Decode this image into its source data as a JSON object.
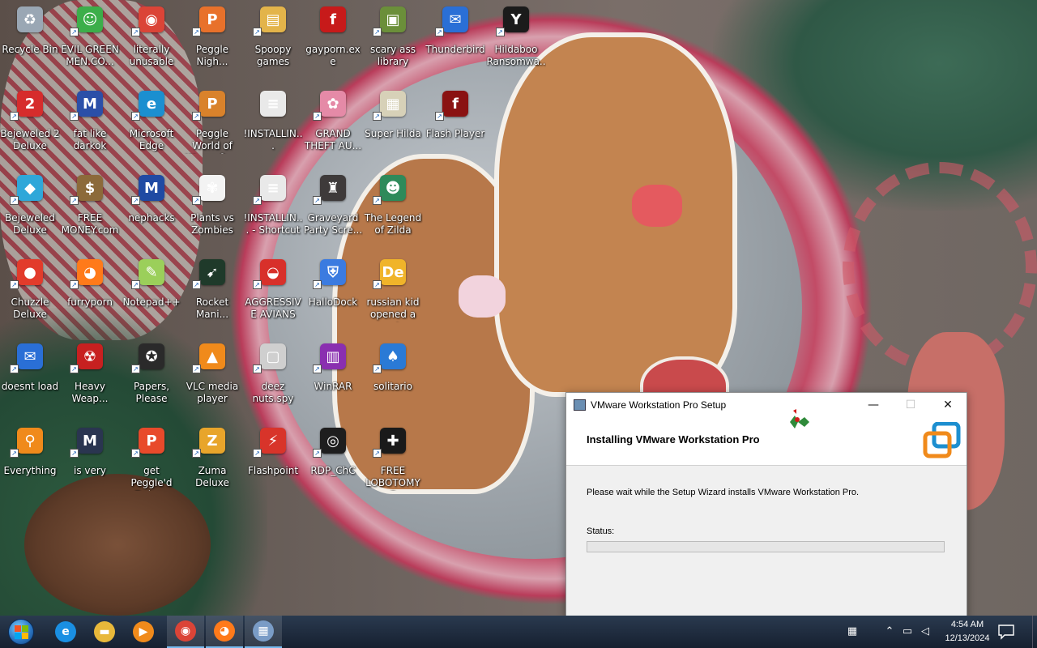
{
  "desktop_icons": [
    {
      "label": "Recycle Bin",
      "icon": "recycle-bin-icon",
      "color": "#9aa7b4",
      "glyph": "♻",
      "shortcut": false
    },
    {
      "label": "EVIL GREEN MEN.CO...",
      "icon": "people-icon",
      "color": "#3cae4a",
      "glyph": "☺",
      "shortcut": true
    },
    {
      "label": "literally unusable",
      "icon": "chrome-icon",
      "color": "#db4437",
      "glyph": "◉",
      "shortcut": true
    },
    {
      "label": "Peggle Nigh...",
      "icon": "peggle-icon",
      "color": "#e8712b",
      "glyph": "P",
      "shortcut": true
    },
    {
      "label": "Spoopy games",
      "icon": "folder-icon",
      "color": "#e3b44a",
      "glyph": "▤",
      "shortcut": true
    },
    {
      "label": "gayporn.exe",
      "icon": "flash-icon",
      "color": "#c71a1a",
      "glyph": "f",
      "shortcut": false
    },
    {
      "label": "scary ass library",
      "icon": "library-icon",
      "color": "#6b8f3a",
      "glyph": "▣",
      "shortcut": true
    },
    {
      "label": "Thunderbird",
      "icon": "thunderbird-icon",
      "color": "#2a6fd6",
      "glyph": "✉",
      "shortcut": true
    },
    {
      "label": "Hildaboo Ransomwa...",
      "icon": "yashma-icon",
      "color": "#1b1b1b",
      "glyph": "Y",
      "shortcut": true
    },
    {
      "label": "Bejeweled 2 Deluxe",
      "icon": "bejeweled2-icon",
      "color": "#d62c2c",
      "glyph": "2",
      "shortcut": true
    },
    {
      "label": "fat like darkok",
      "icon": "mpi-icon",
      "color": "#2b4fa8",
      "glyph": "M",
      "shortcut": true
    },
    {
      "label": "Microsoft Edge",
      "icon": "edge-icon",
      "color": "#1b8fd0",
      "glyph": "e",
      "shortcut": true
    },
    {
      "label": "Peggle World of Warcraft ...",
      "icon": "peggle-wow-icon",
      "color": "#d9822b",
      "glyph": "P",
      "shortcut": true
    },
    {
      "label": "!INSTALLIN...",
      "icon": "text-file-icon",
      "color": "#e9e9e9",
      "glyph": "≡",
      "shortcut": false
    },
    {
      "label": "GRAND THEFT AU...",
      "icon": "anime-girl-icon",
      "color": "#e58aa7",
      "glyph": "✿",
      "shortcut": true
    },
    {
      "label": "Super Hilda",
      "icon": "pixel-hilda-icon",
      "color": "#d7d1b8",
      "glyph": "▦",
      "shortcut": true
    },
    {
      "label": "Flash Player",
      "icon": "flash-player-icon",
      "color": "#8a1212",
      "glyph": "f",
      "shortcut": true
    },
    {
      "label": "Bejeweled Deluxe",
      "icon": "bejeweled-icon",
      "color": "#2fa7d9",
      "glyph": "◆",
      "shortcut": true
    },
    {
      "label": "FREE MONEY.com",
      "icon": "money-bag-icon",
      "color": "#8c6a3a",
      "glyph": "$",
      "shortcut": true
    },
    {
      "label": "nephacks",
      "icon": "mpi-icon",
      "color": "#1f4aa3",
      "glyph": "M",
      "shortcut": true
    },
    {
      "label": "Plants vs Zombies",
      "icon": "pvz-icon",
      "color": "#f3f3f3",
      "glyph": "✾",
      "shortcut": true
    },
    {
      "label": "!INSTALLIN... - Shortcut",
      "icon": "text-file-icon",
      "color": "#e9e9e9",
      "glyph": "≡",
      "shortcut": true
    },
    {
      "label": "Graveyard Party Scre...",
      "icon": "graveyard-icon",
      "color": "#3e3a3a",
      "glyph": "♜",
      "shortcut": true
    },
    {
      "label": "The Legend of Zilda",
      "icon": "zilda-icon",
      "color": "#2e8a5a",
      "glyph": "☻",
      "shortcut": true
    },
    {
      "label": "Chuzzle Deluxe",
      "icon": "chuzzle-icon",
      "color": "#e23b2b",
      "glyph": "●",
      "shortcut": true
    },
    {
      "label": "furryporn",
      "icon": "firefox-icon",
      "color": "#ff7a1a",
      "glyph": "◕",
      "shortcut": true
    },
    {
      "label": "Notepad++",
      "icon": "notepadpp-icon",
      "color": "#9bcf5a",
      "glyph": "✎",
      "shortcut": true
    },
    {
      "label": "Rocket Mani...",
      "icon": "rocket-icon",
      "color": "#1f3a2a",
      "glyph": "➹",
      "shortcut": true
    },
    {
      "label": "AGGRESSIVE AVIANS",
      "icon": "angry-bird-icon",
      "color": "#d8302a",
      "glyph": "◒",
      "shortcut": true
    },
    {
      "label": "HalloDock",
      "icon": "windows-shield-icon",
      "color": "#3b7be0",
      "glyph": "⛨",
      "shortcut": true
    },
    {
      "label": "russian kid opened a rat",
      "icon": "de-icon",
      "color": "#f0b42a",
      "glyph": "De",
      "shortcut": true
    },
    {
      "label": "doesnt load",
      "icon": "thunderbird-icon",
      "color": "#2a6fd6",
      "glyph": "✉",
      "shortcut": true
    },
    {
      "label": "Heavy Weap...",
      "icon": "radiation-icon",
      "color": "#c72020",
      "glyph": "☢",
      "shortcut": true
    },
    {
      "label": "Papers, Please",
      "icon": "papers-please-icon",
      "color": "#2a2a2a",
      "glyph": "✪",
      "shortcut": true
    },
    {
      "label": "VLC media player",
      "icon": "vlc-icon",
      "color": "#f08a1b",
      "glyph": "▲",
      "shortcut": true
    },
    {
      "label": "deez nuts.spy",
      "icon": "files-icon",
      "color": "#cfcfcf",
      "glyph": "▢",
      "shortcut": true
    },
    {
      "label": "WinRAR",
      "icon": "winrar-icon",
      "color": "#8a2fb0",
      "glyph": "▥",
      "shortcut": true
    },
    {
      "label": "solitario",
      "icon": "solitaire-icon",
      "color": "#2a7ad6",
      "glyph": "♠",
      "shortcut": true
    },
    {
      "label": "Everything",
      "icon": "search-icon",
      "color": "#f08a1b",
      "glyph": "⚲",
      "shortcut": true
    },
    {
      "label": "is very",
      "icon": "mpi-shield-icon",
      "color": "#2a3550",
      "glyph": "M",
      "shortcut": true
    },
    {
      "label": "get Peggle'd Deluxe",
      "icon": "peggle-deluxe-icon",
      "color": "#e84a2b",
      "glyph": "P",
      "shortcut": true
    },
    {
      "label": "Zuma Deluxe",
      "icon": "zuma-icon",
      "color": "#e8a52b",
      "glyph": "Z",
      "shortcut": true
    },
    {
      "label": "Flashpoint",
      "icon": "flashpoint-icon",
      "color": "#d8342a",
      "glyph": "⚡",
      "shortcut": true
    },
    {
      "label": "RDP_ChC",
      "icon": "rdp-icon",
      "color": "#1e1e1e",
      "glyph": "◎",
      "shortcut": true
    },
    {
      "label": "FREE LOBOTOMYS",
      "icon": "lobotomy-icon",
      "color": "#1a1a1a",
      "glyph": "✚",
      "shortcut": true
    }
  ],
  "installer": {
    "window_title": "VMware Workstation Pro Setup",
    "minimize": "—",
    "maximize": "☐",
    "close": "✕",
    "header_title": "Installing VMware Workstation Pro",
    "wait_text": "Please wait while the Setup Wizard installs VMware Workstation Pro.",
    "status_label": "Status:",
    "progress": 0
  },
  "taskbar": {
    "pinned": [
      {
        "icon": "ie-icon",
        "glyph": "e",
        "color": "#1a8fe3"
      },
      {
        "icon": "file-explorer-icon",
        "glyph": "▬",
        "color": "#e8b83a"
      },
      {
        "icon": "media-player-icon",
        "glyph": "▶",
        "color": "#f08a1b"
      },
      {
        "icon": "chrome-icon",
        "glyph": "◉",
        "color": "#db4437"
      },
      {
        "icon": "firefox-icon",
        "glyph": "◕",
        "color": "#ff7a1a"
      },
      {
        "icon": "setup-icon",
        "glyph": "▦",
        "color": "#7a9cc6"
      }
    ],
    "time": "4:54 AM",
    "date": "12/13/2024"
  }
}
